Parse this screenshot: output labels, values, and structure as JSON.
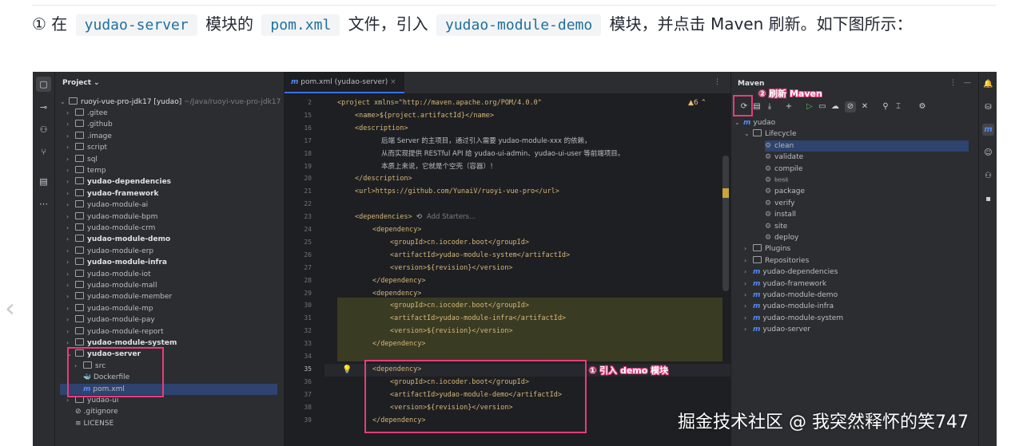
{
  "paragraph": {
    "circled_one": "①",
    "t1": "在",
    "code1": "yudao-server",
    "t2": "模块的",
    "code2": "pom.xml",
    "t3": "文件，引入",
    "code3": "yudao-module-demo",
    "t4": "模块，并点击 Maven 刷新。如下图所示："
  },
  "project_panel": {
    "title": "Project",
    "root": "ruoyi-vue-pro-jdk17 [yudao]",
    "root_path": "~/Java/ruoyi-vue-pro-jdk17",
    "items": [
      {
        "label": ".gitee",
        "bold": false
      },
      {
        "label": ".github",
        "bold": false
      },
      {
        "label": ".image",
        "bold": false
      },
      {
        "label": "script",
        "bold": false
      },
      {
        "label": "sql",
        "bold": false
      },
      {
        "label": "temp",
        "bold": false
      },
      {
        "label": "yudao-dependencies",
        "bold": true
      },
      {
        "label": "yudao-framework",
        "bold": true
      },
      {
        "label": "yudao-module-ai",
        "bold": false
      },
      {
        "label": "yudao-module-bpm",
        "bold": false
      },
      {
        "label": "yudao-module-crm",
        "bold": false
      },
      {
        "label": "yudao-module-demo",
        "bold": true
      },
      {
        "label": "yudao-module-erp",
        "bold": false
      },
      {
        "label": "yudao-module-infra",
        "bold": true
      },
      {
        "label": "yudao-module-iot",
        "bold": false
      },
      {
        "label": "yudao-module-mall",
        "bold": false
      },
      {
        "label": "yudao-module-member",
        "bold": false
      },
      {
        "label": "yudao-module-mp",
        "bold": false
      },
      {
        "label": "yudao-module-pay",
        "bold": false
      },
      {
        "label": "yudao-module-report",
        "bold": false
      },
      {
        "label": "yudao-module-system",
        "bold": true
      },
      {
        "label": "yudao-server",
        "bold": true
      },
      {
        "label": "src",
        "bold": false
      },
      {
        "label": "Dockerfile",
        "bold": false
      },
      {
        "label": "pom.xml",
        "bold": false
      },
      {
        "label": "yudao-ui",
        "bold": false
      },
      {
        "label": ".gitignore",
        "bold": false
      },
      {
        "label": "LICENSE",
        "bold": false
      }
    ]
  },
  "editor": {
    "tab_label": "pom.xml (yudao-server)",
    "warning_count": "6",
    "lines": [
      {
        "n": "2",
        "text": "<project xmlns=\"http://maven.apache.org/POM/4.0.0\""
      },
      {
        "n": "15",
        "text": "<name>${project.artifactId}</name>"
      },
      {
        "n": "16",
        "text": "<description>"
      },
      {
        "n": "17",
        "text": "后端 Server 的主项目，通过引入需要 yudao-module-xxx 的依赖，"
      },
      {
        "n": "18",
        "text": "从而实现提供 RESTful API 给 yudao-ui-admin、yudao-ui-user 等前端项目。"
      },
      {
        "n": "19",
        "text": "本质上来说，它就是个空壳（容器）！"
      },
      {
        "n": "20",
        "text": "</description>"
      },
      {
        "n": "21",
        "text": "<url>https://github.com/YunaiV/ruoyi-vue-pro</url>"
      },
      {
        "n": "22",
        "text": ""
      },
      {
        "n": "23",
        "text": "<dependencies>"
      },
      {
        "n": "24",
        "text": "<dependency>"
      },
      {
        "n": "25",
        "text": "<groupId>cn.iocoder.boot</groupId>"
      },
      {
        "n": "26",
        "text": "<artifactId>yudao-module-system</artifactId>"
      },
      {
        "n": "27",
        "text": "<version>${revision}</version>"
      },
      {
        "n": "28",
        "text": "</dependency>"
      },
      {
        "n": "29",
        "text": "<dependency>"
      },
      {
        "n": "30",
        "text": "<groupId>cn.iocoder.boot</groupId>"
      },
      {
        "n": "31",
        "text": "<artifactId>yudao-module-infra</artifactId>"
      },
      {
        "n": "32",
        "text": "<version>${revision}</version>"
      },
      {
        "n": "33",
        "text": "</dependency>"
      },
      {
        "n": "34",
        "text": ""
      },
      {
        "n": "35",
        "text": "<dependency>"
      },
      {
        "n": "36",
        "text": "<groupId>cn.iocoder.boot</groupId>"
      },
      {
        "n": "37",
        "text": "<artifactId>yudao-module-demo</artifactId>"
      },
      {
        "n": "38",
        "text": "<version>${revision}</version>"
      },
      {
        "n": "39",
        "text": "</dependency>"
      }
    ],
    "add_starters": "Add Starters..."
  },
  "maven_panel": {
    "title": "Maven",
    "root": "yudao",
    "lifecycle": "Lifecycle",
    "goals": [
      "clean",
      "validate",
      "compile",
      "test",
      "package",
      "verify",
      "install",
      "site",
      "deploy"
    ],
    "plugins": "Plugins",
    "repositories": "Repositories",
    "modules": [
      "yudao-dependencies",
      "yudao-framework",
      "yudao-module-demo",
      "yudao-module-infra",
      "yudao-module-system",
      "yudao-server"
    ]
  },
  "annotations": {
    "refresh": "② 刷新 Maven",
    "import_demo": "① 引入 demo 模块"
  },
  "watermark": "掘金技术社区 @ 我突然释怀的笑747",
  "colors": {
    "accent": "#3574f0",
    "annotation": "#e83c7c",
    "ide_bg": "#1e1f22",
    "panel_bg": "#2b2d30"
  }
}
